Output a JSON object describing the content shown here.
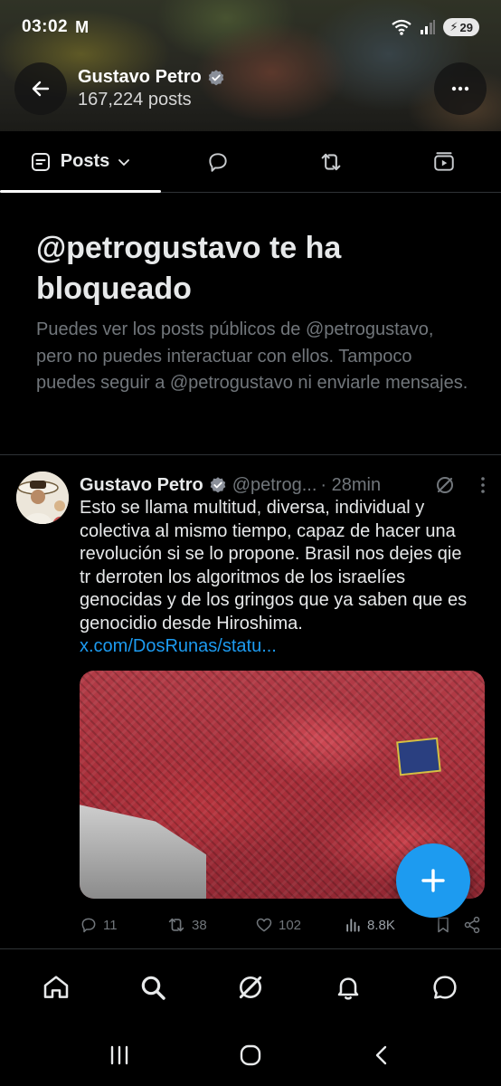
{
  "status_bar": {
    "time": "03:02",
    "carrier": "M",
    "battery": "29"
  },
  "header": {
    "name": "Gustavo Petro",
    "post_count": "167,224 posts"
  },
  "tabs": {
    "posts_label": "Posts"
  },
  "blocked_notice": {
    "title": "@petrogustavo te ha bloqueado",
    "description": "Puedes ver los posts públicos de @petrogustavo, pero no puedes interactuar con ellos. Tampoco puedes seguir a @petrogustavo ni enviarle mensajes."
  },
  "tweet": {
    "author_name": "Gustavo Petro",
    "handle": "@petrog...",
    "time": "· 28min",
    "text": "Esto se llama multitud, diversa, individual y colectiva  al mismo tiempo, capaz de hacer una revolución si se lo propone. Brasil nos dejes qie tr derroten los algoritmos de los israelíes genocidas y de los gringos que ya saben que es genocidio desde Hiroshima.",
    "link": "x.com/DosRunas/statu...",
    "stats": {
      "replies": "11",
      "reposts": "38",
      "likes": "102",
      "views": "8.8K"
    }
  },
  "colors": {
    "accent": "#1d9bf0",
    "background": "#000000",
    "secondary_text": "#71767b",
    "divider": "#2f3336"
  },
  "icons": {
    "back": "arrow-left-icon",
    "more": "more-horizontal-icon",
    "verified": "verified-badge-icon",
    "fab": "plus-icon"
  }
}
